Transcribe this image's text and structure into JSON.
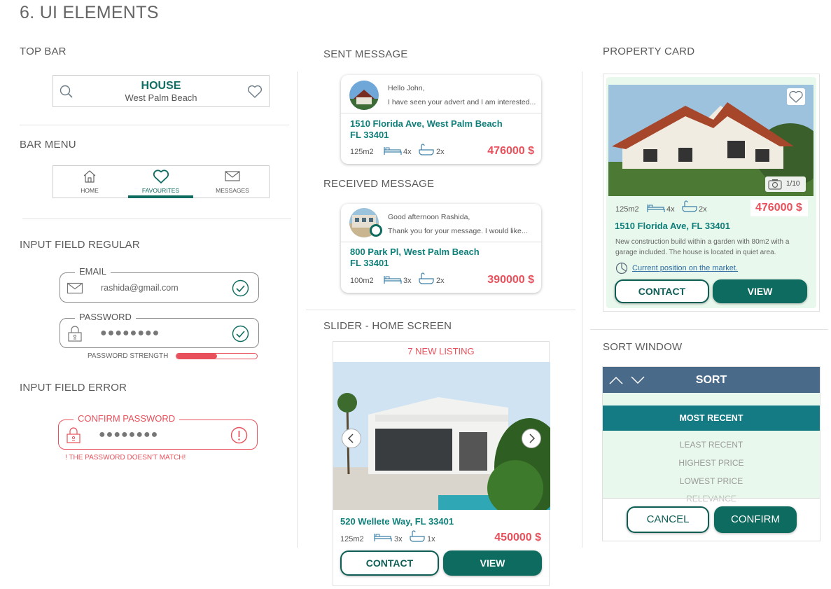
{
  "page_title": "6. UI ELEMENTS",
  "sections": {
    "top_bar": "TOP BAR",
    "bar_menu": "BAR MENU",
    "input_regular": "INPUT FIELD REGULAR",
    "input_error": "INPUT FIELD ERROR",
    "sent_message": "SENT MESSAGE",
    "received_message": "RECEIVED MESSAGE",
    "slider": "SLIDER - HOME SCREEN",
    "property_card": "PROPERTY CARD",
    "sort_window": "SORT WINDOW"
  },
  "top_bar": {
    "title": "HOUSE",
    "subtitle": "West Palm Beach"
  },
  "bar_menu": {
    "items": [
      {
        "label": "HOME",
        "icon": "home-icon"
      },
      {
        "label": "FAVOURITES",
        "icon": "heart-icon",
        "active": true
      },
      {
        "label": "MESSAGES",
        "icon": "envelope-icon"
      }
    ]
  },
  "inputs": {
    "email": {
      "label": "EMAIL",
      "value": "rashida@gmail.com"
    },
    "password": {
      "label": "PASSWORD",
      "value": "●●●●●●●●",
      "strength_label": "PASSWORD STRENGTH",
      "strength": 0.5
    },
    "confirm": {
      "label": "CONFIRM PASSWORD",
      "value": "●●●●●●●●",
      "error": "! THE PASSWORD DOESN'T MATCH!"
    }
  },
  "sent_message": {
    "line1": "Hello John,",
    "line2": "I have seen your advert and I am interested...",
    "address1": "1510 Florida Ave, West Palm Beach",
    "address2": "FL 33401",
    "area": "125m2",
    "beds": "4x",
    "baths": "2x",
    "price": "476000 $"
  },
  "received_message": {
    "line1": "Good afternoon Rashida,",
    "line2": "Thank you for your message. I would like...",
    "address1": "800 Park Pl, West Palm Beach",
    "address2": "FL 33401",
    "area": "100m2",
    "beds": "3x",
    "baths": "2x",
    "price": "390000 $"
  },
  "slider": {
    "banner": "7 NEW LISTING",
    "address": "520 Wellete Way, FL 33401",
    "area": "125m2",
    "beds": "3x",
    "baths": "1x",
    "price": "450000 $",
    "contact": "CONTACT",
    "view": "VIEW"
  },
  "property_card": {
    "photo_count": "1/10",
    "area": "125m2",
    "beds": "4x",
    "baths": "2x",
    "price": "476000 $",
    "address": "1510 Florida Ave, FL 33401",
    "desc1": "New construction build within a garden with 80m2 with a",
    "desc2": "garage included.  The house is located in quiet area.",
    "market_link": "Current position on the market.",
    "contact": "CONTACT",
    "view": "VIEW"
  },
  "sort": {
    "title": "SORT",
    "options": [
      "MOST RECENT",
      "LEAST RECENT",
      "HIGHEST PRICE",
      "LOWEST PRICE",
      "RELEVANCE"
    ],
    "selected": "MOST RECENT",
    "cancel": "CANCEL",
    "confirm": "CONFIRM"
  },
  "colors": {
    "brand": "#0d6b5f",
    "accent": "#0f7f7a",
    "error": "#e8505b",
    "sort_header": "#4a6a8a",
    "selected_bg": "#147b85",
    "mint": "#e9f8ec"
  }
}
